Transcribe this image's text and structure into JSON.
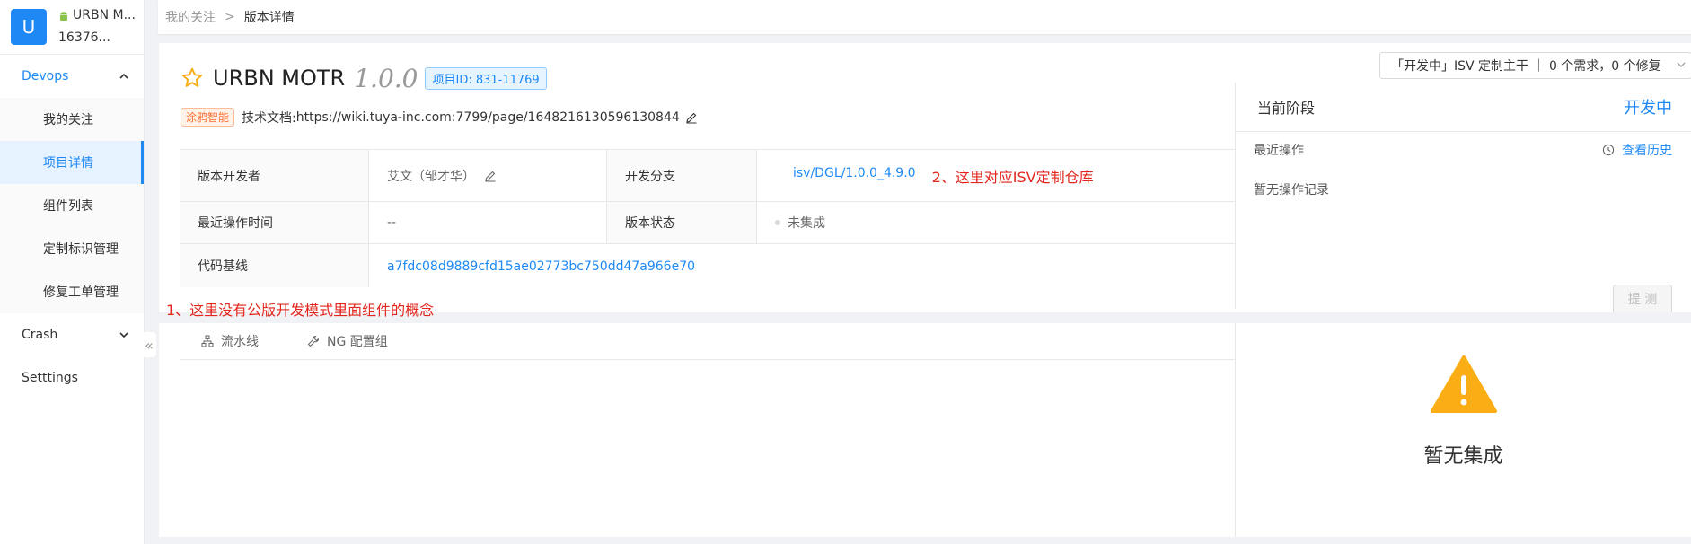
{
  "app": {
    "avatar_letter": "U",
    "name": "URBN M...",
    "sub": "16376..."
  },
  "sidebar": {
    "devops_label": "Devops",
    "devops_items": [
      "我的关注",
      "项目详情",
      "组件列表",
      "定制标识管理",
      "修复工单管理"
    ],
    "crash_label": "Crash",
    "settings_label": "Setttings"
  },
  "breadcrumb": {
    "parent": "我的关注",
    "sep": ">",
    "current": "版本详情"
  },
  "project": {
    "name": "URBN MOTR",
    "version": "1.0.0",
    "id_badge": "项目ID: 831-11769",
    "branch_select": "「开发中」ISV 定制主干 ｜ 0 个需求，0 个修复"
  },
  "doc": {
    "tag": "涂鸦智能",
    "label": "技术文档:",
    "url": "https://wiki.tuya-inc.com:7799/page/1648216130596130844"
  },
  "details": {
    "developer_label": "版本开发者",
    "developer_value": "艾文（邹才华）",
    "branch_label": "开发分支",
    "branch_value": "isv/DGL/1.0.0_4.9.0",
    "last_op_label": "最近操作时间",
    "last_op_value": "--",
    "status_label": "版本状态",
    "status_value": "未集成",
    "baseline_label": "代码基线",
    "baseline_value": "a7fdc08d9889cfd15ae02773bc750dd47a966e70"
  },
  "annotations": {
    "note1": "1、这里没有公版开发模式里面组件的概念",
    "note2": "2、这里对应ISV定制仓库"
  },
  "stage": {
    "title": "当前阶段",
    "value": "开发中",
    "recent_label": "最近操作",
    "history_link": "查看历史",
    "no_records": "暂无操作记录",
    "submit": "提 测"
  },
  "tabs": [
    "流水线",
    "NG 配置组"
  ],
  "empty": {
    "text": "暂无集成"
  },
  "colors": {
    "accent": "#1e88f5",
    "annotation": "#e3261e",
    "warning": "#faad14"
  }
}
